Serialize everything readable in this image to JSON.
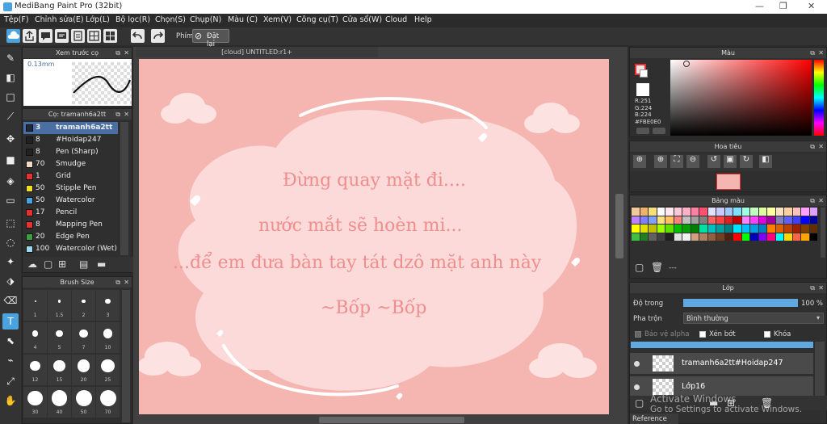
{
  "window": {
    "title": "MediBang Paint Pro (32bit)"
  },
  "menu": [
    "Tệp(F)",
    "Chỉnh sửa(E)",
    "Lớp(L)",
    "Bộ lọc(R)",
    "Chọn(S)",
    "Chụp(N)",
    "Màu (C)",
    "Xem(V)",
    "Công cụ(T)",
    "Cửa sổ(W)",
    "Cloud",
    "Help"
  ],
  "toolbar": {
    "key_label": "Phím",
    "reset_label": "Đặt lại"
  },
  "brush_preview": {
    "title": "Xem trước cọ",
    "size": "0.13mm"
  },
  "brush_panel": {
    "title": "Cọ: tramanh6a2tt",
    "items": [
      {
        "size": "3",
        "name": "tramanh6a2tt",
        "color": "#1e2a3a"
      },
      {
        "size": "8",
        "name": "#Hoidap247",
        "color": "#222222"
      },
      {
        "size": "8",
        "name": "Pen (Sharp)",
        "color": "#222222"
      },
      {
        "size": "70",
        "name": "Smudge",
        "color": "#f3d9c7"
      },
      {
        "size": "1",
        "name": "Grid",
        "color": "#e83030"
      },
      {
        "size": "50",
        "name": "Stipple Pen",
        "color": "#f0e020"
      },
      {
        "size": "50",
        "name": "Watercolor",
        "color": "#4aa3df"
      },
      {
        "size": "17",
        "name": "Pencil",
        "color": "#e83030"
      },
      {
        "size": "8",
        "name": "Mapping Pen",
        "color": "#e83030"
      },
      {
        "size": "20",
        "name": "Edge Pen",
        "color": "#3aa040"
      },
      {
        "size": "100",
        "name": "Watercolor (Wet)",
        "color": "#9fd8ee"
      }
    ]
  },
  "brush_size": {
    "title": "Brush Size",
    "sizes": [
      "1",
      "1.5",
      "2",
      "3",
      "4",
      "5",
      "7",
      "10",
      "12",
      "15",
      "20",
      "25",
      "30",
      "40",
      "50",
      "70"
    ]
  },
  "document": {
    "tab": "[cloud] UNTITLED:r1+"
  },
  "canvas_text": {
    "line1": "Đừng quay mặt đi....",
    "line2": "nước mắt sẽ hoèn mi...",
    "line3": "...để em đưa bàn tay tát dzô mặt anh này",
    "line4": "~Bốp ~Bốp"
  },
  "color_panel": {
    "title": "Màu",
    "r": "R:251",
    "g": "G:224",
    "b": "B:224",
    "hex": "#FBE0E0",
    "main_color": "#fbe0e0"
  },
  "navigator": {
    "title": "Hoa tiêu"
  },
  "palette": {
    "title": "Bảng màu",
    "add_label": "---",
    "colors": [
      "#f3c89b",
      "#f0b26a",
      "#f7e07a",
      "#ffffff",
      "#ffe8f0",
      "#ffc8d8",
      "#ffb0c8",
      "#ff80a0",
      "#ff5070",
      "#e0e0ff",
      "#c8c8ff",
      "#a0c8ff",
      "#80e0ff",
      "#a0ffe0",
      "#c0ffc0",
      "#e0ffa0",
      "#ffffa0",
      "#ffe0c0",
      "#ffd0a0",
      "#ffc0c0",
      "#ffa0ff",
      "#e0a0ff",
      "#c080ff",
      "#8080ff",
      "#80a0ff",
      "#ffe080",
      "#ffc060",
      "#ff8080",
      "#c0c0c0",
      "#a0a0a0",
      "#808080",
      "#ff6060",
      "#ff4040",
      "#e02020",
      "#c00000",
      "#ff80ff",
      "#ff40ff",
      "#e000e0",
      "#a000a0",
      "#8080c0",
      "#6060ff",
      "#4040ff",
      "#0000ff",
      "#0000a0",
      "#ffff00",
      "#e0e000",
      "#c0c000",
      "#a0ff00",
      "#60e000",
      "#00c000",
      "#00a000",
      "#008000",
      "#00e0a0",
      "#00c0c0",
      "#00a0a0",
      "#008080",
      "#00e0ff",
      "#00c0ff",
      "#00a0e0",
      "#0080c0",
      "#ff8000",
      "#e06000",
      "#c04000",
      "#a02000",
      "#804000",
      "#603000",
      "#40c040",
      "#208020",
      "#606060",
      "#404040",
      "#202020",
      "#e0e0e0",
      "#f0f0f0",
      "#d0a080",
      "#b08060",
      "#906040",
      "#704020",
      "#502010",
      "#ff0000",
      "#00ff00",
      "#0000c0",
      "#8000ff",
      "#ff0080",
      "#00ffff",
      "#ffd700",
      "#ff6347",
      "#ffa500",
      "#000000"
    ]
  },
  "layer_panel": {
    "title": "Lớp",
    "opacity_label": "Độ trong",
    "opacity_value": "100 %",
    "opacity_fraction": 1.0,
    "blend_label": "Pha trộn",
    "blend_value": "Bình thường",
    "protect_alpha": "Bảo vệ alpha",
    "clipping": "Xén bớt",
    "lock": "Khóa",
    "layers": [
      "tramanh6a2tt#Hoidap247",
      "Lớp16"
    ]
  },
  "reference_tab": "Reference",
  "watermark": {
    "line1": "Activate Windows",
    "line2": "Go to Settings to activate Windows."
  }
}
